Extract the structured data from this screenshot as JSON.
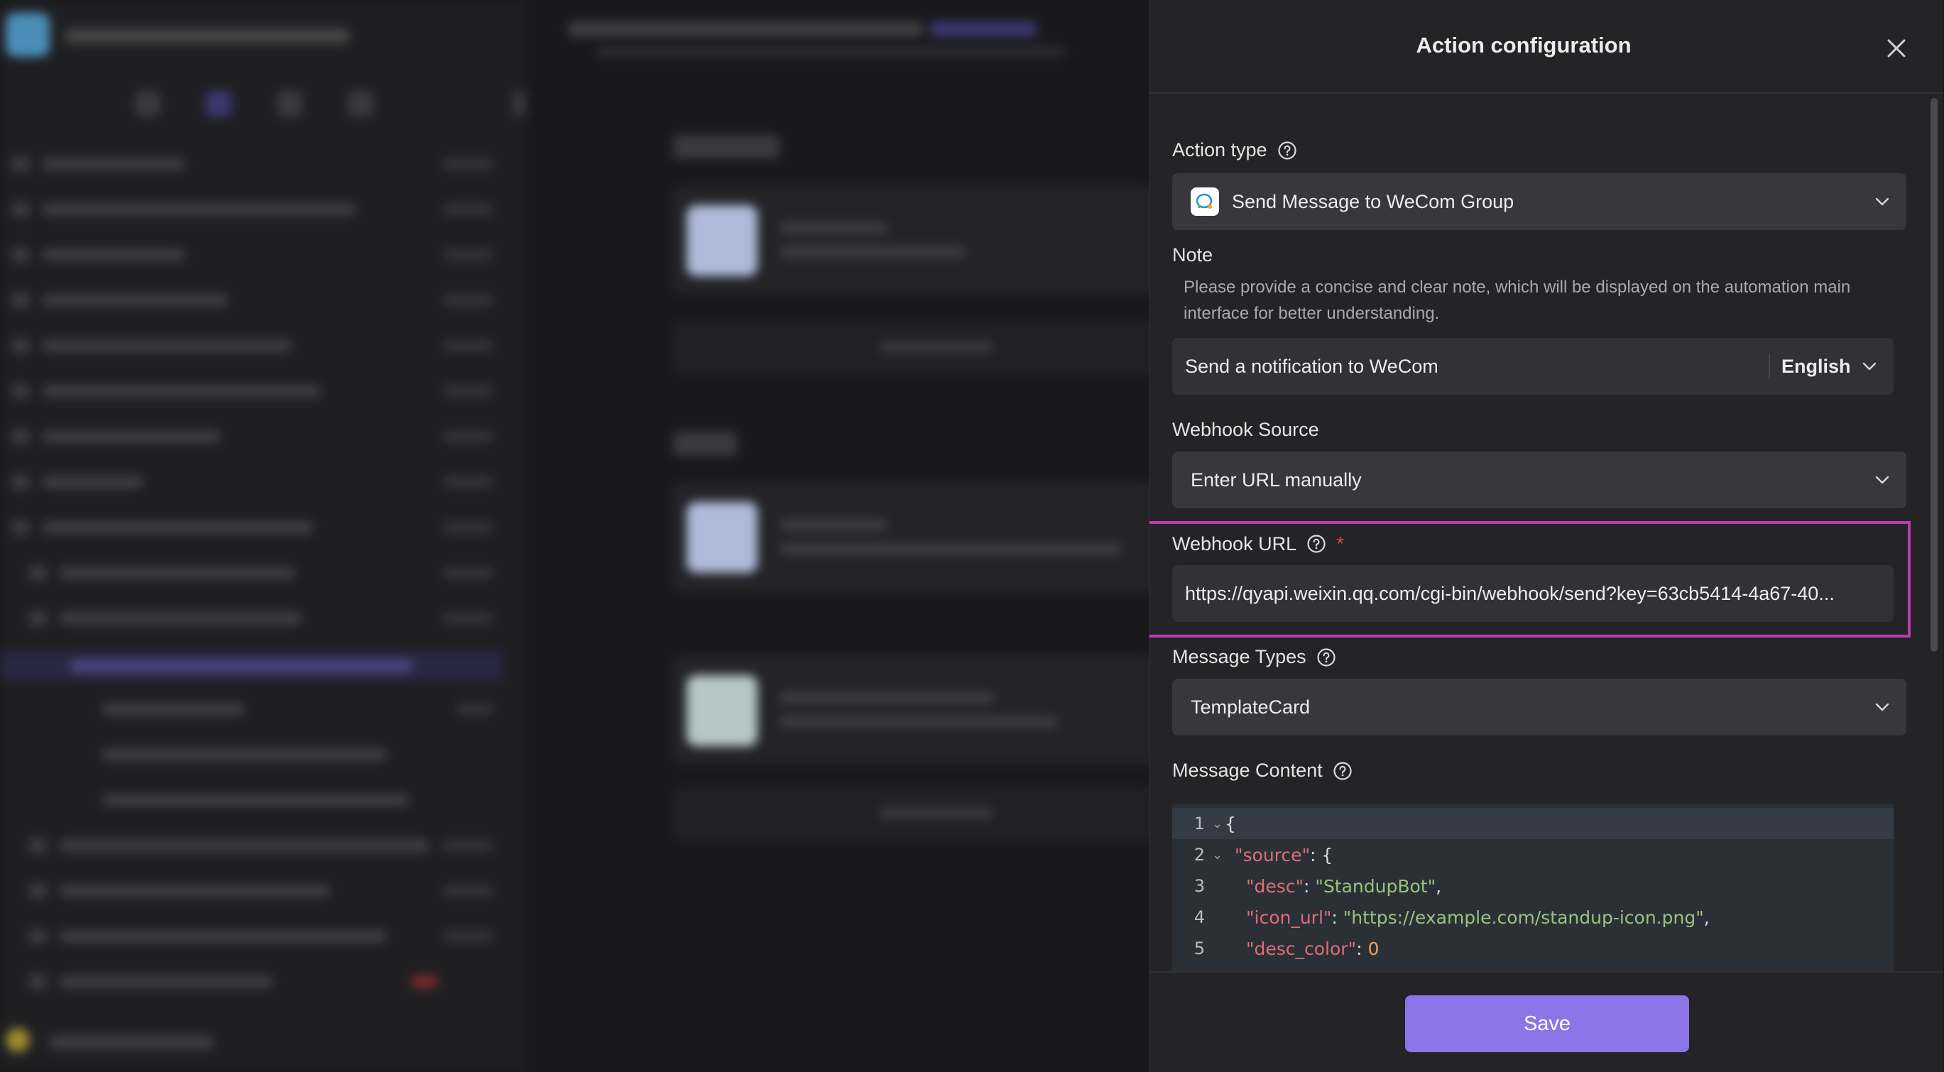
{
  "panel": {
    "title": "Action configuration"
  },
  "action_type": {
    "label": "Action type",
    "value": "Send Message to WeCom Group"
  },
  "note": {
    "label": "Note",
    "hint": "Please provide a concise and clear note, which will be displayed on the automation main interface for better understanding.",
    "value": "Send a notification to WeCom",
    "language": "English"
  },
  "webhook_source": {
    "label": "Webhook Source",
    "value": "Enter URL manually"
  },
  "webhook_url": {
    "label": "Webhook URL",
    "required_mark": "*",
    "value": "https://qyapi.weixin.qq.com/cgi-bin/webhook/send?key=63cb5414-4a67-40..."
  },
  "message_types": {
    "label": "Message Types",
    "value": "TemplateCard"
  },
  "message_content": {
    "label": "Message Content",
    "lines": [
      {
        "n": "1",
        "p1": "{"
      },
      {
        "n": "2",
        "key": "\"source\"",
        "p1": ": {"
      },
      {
        "n": "3",
        "key": "\"desc\"",
        "p1": ": ",
        "str": "\"StandupBot\"",
        "p2": ","
      },
      {
        "n": "4",
        "key": "\"icon_url\"",
        "p1": ": ",
        "str": "\"https://example.com/standup-icon.png\"",
        "p2": ","
      },
      {
        "n": "5",
        "key": "\"desc_color\"",
        "p1": ": ",
        "num": "0"
      }
    ]
  },
  "footer": {
    "save_label": "Save"
  },
  "colors": {
    "accent": "#8b75e8",
    "highlight": "#b73db3",
    "required": "#e5484d"
  }
}
